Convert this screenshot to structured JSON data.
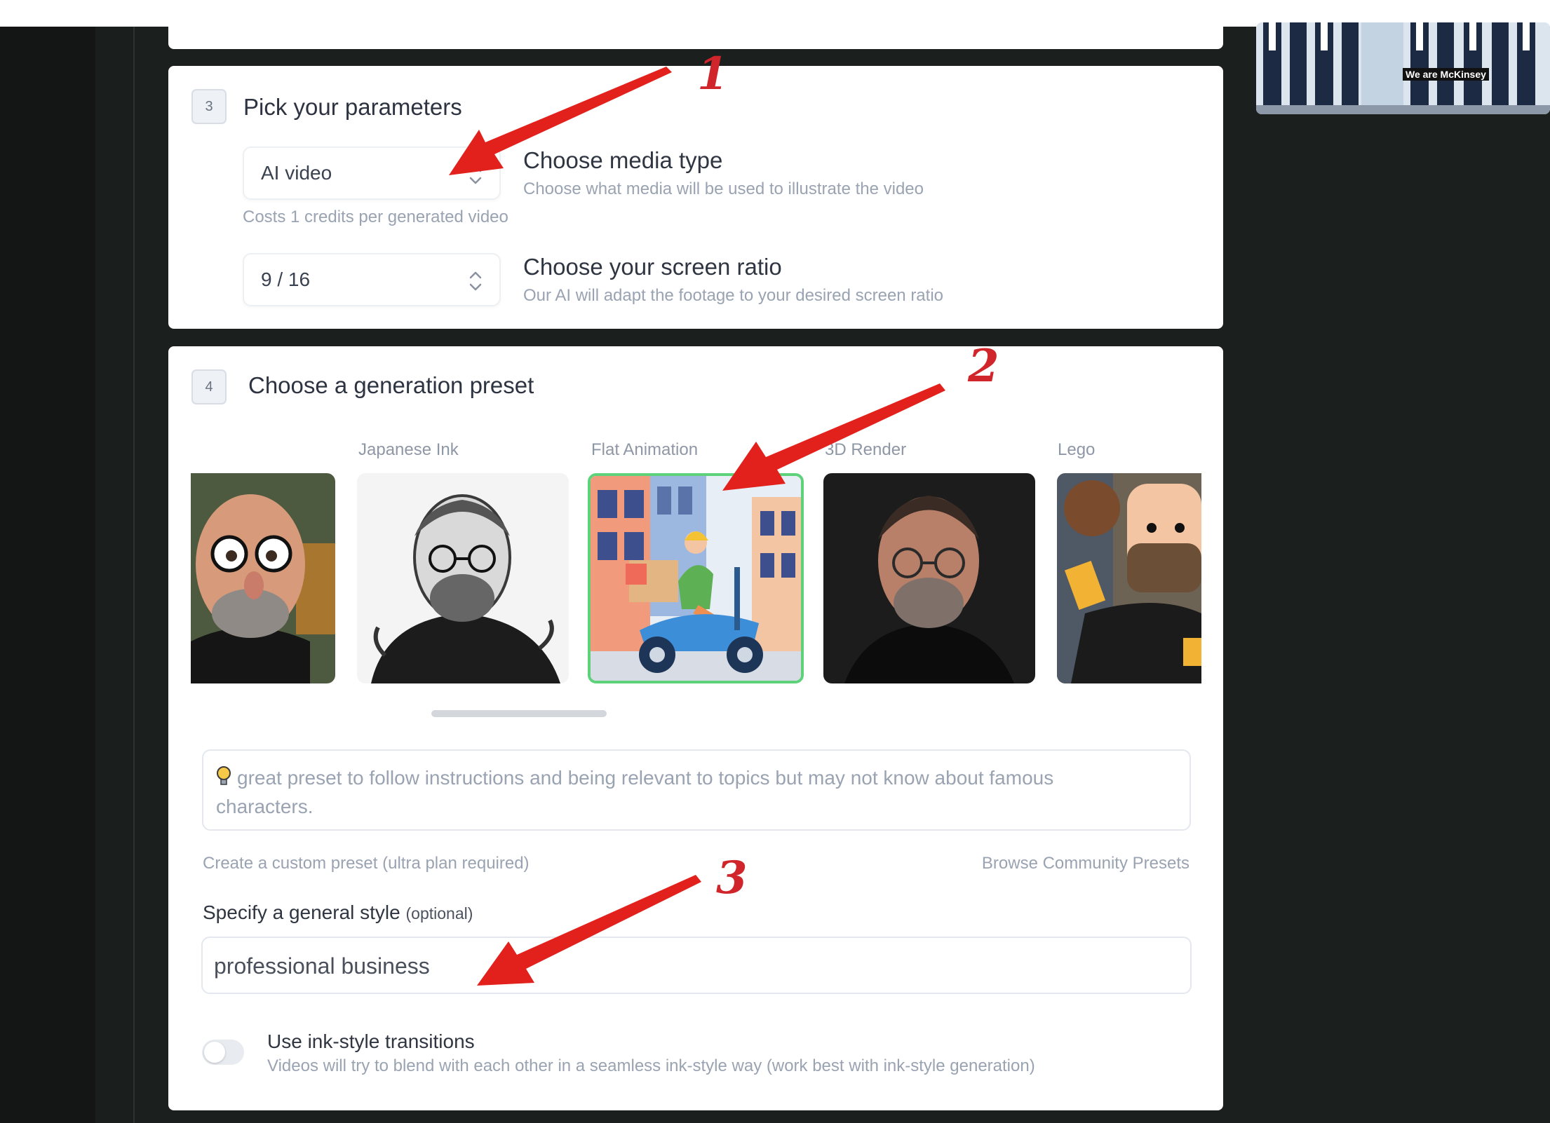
{
  "params": {
    "step": "3",
    "title": "Pick your parameters",
    "media_select_value": "AI video",
    "media_title": "Choose media type",
    "media_desc": "Choose what media will be used to illustrate the video",
    "cost_note": "Costs 1 credits per generated video",
    "ratio_select_value": "9 / 16",
    "ratio_title": "Choose your screen ratio",
    "ratio_desc": "Our AI will adapt the footage to your desired screen ratio"
  },
  "preset": {
    "step": "4",
    "title": "Choose a generation preset",
    "items": [
      {
        "label": "",
        "icon": "cartoon-portrait"
      },
      {
        "label": "Japanese Ink",
        "icon": "ink-portrait"
      },
      {
        "label": "Flat Animation",
        "icon": "flat-scooter",
        "selected": true
      },
      {
        "label": "3D Render",
        "icon": "render-portrait"
      },
      {
        "label": "Lego",
        "icon": "lego-figure"
      }
    ],
    "tip": "great preset to follow instructions and being relevant to topics but may not know about famous characters.",
    "custom_link": "Create a custom preset (ultra plan required)",
    "community_link": "Browse Community Presets",
    "style_label": "Specify a general style",
    "style_optional": "(optional)",
    "style_value": "professional business",
    "ink_toggle_title": "Use ink-style transitions",
    "ink_toggle_desc": "Videos will try to blend with each other in a seamless ink-style way (work best with ink-style generation)",
    "ink_toggle_on": false
  },
  "side": {
    "caption": "We are McKinsey"
  },
  "annotations": {
    "labels": [
      "1",
      "2",
      "3"
    ],
    "color": "#d0262b"
  },
  "colors": {
    "selected_border": "#5ed27a",
    "background": "#1b1f1e"
  }
}
